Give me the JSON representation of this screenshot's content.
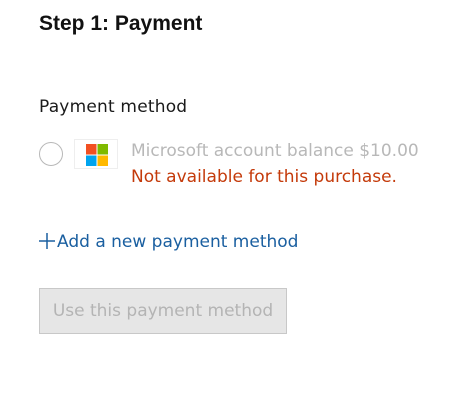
{
  "step": {
    "title": "Step 1: Payment"
  },
  "payment_method": {
    "label": "Payment method",
    "options": [
      {
        "name": "Microsoft account balance $10.00",
        "status": "Not available for this purchase.",
        "selected": false,
        "disabled": true,
        "icon": "microsoft-logo-icon"
      }
    ],
    "add_link": "Add a new payment method",
    "add_icon": "plus-icon",
    "use_button": "Use this payment method",
    "use_button_disabled": true
  },
  "colors": {
    "link": "#1a5fa0",
    "error": "#c43a0a",
    "disabled_text": "#b8b8b8",
    "button_bg": "#e6e6e6",
    "ms_red": "#f25022",
    "ms_green": "#7fba00",
    "ms_blue": "#00a4ef",
    "ms_yellow": "#ffb900"
  }
}
